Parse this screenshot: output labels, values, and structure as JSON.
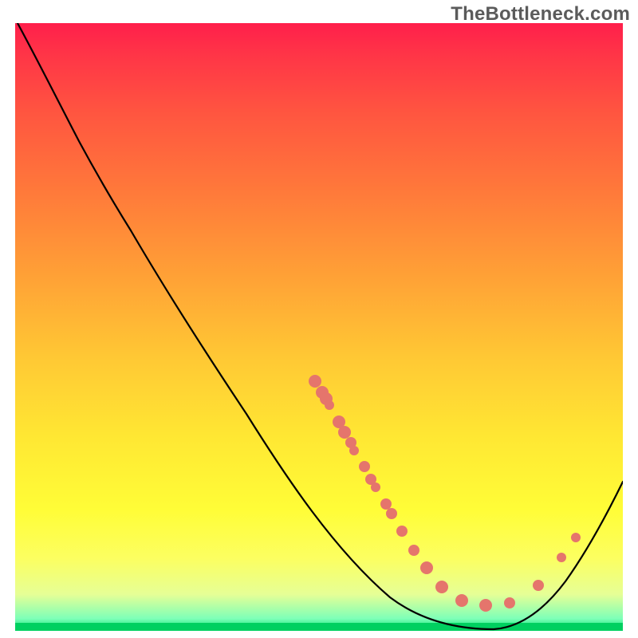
{
  "chart_data": {
    "type": "line",
    "title": "",
    "watermark": "TheBottleneck.com",
    "xlabel": "",
    "ylabel": "",
    "xlim": [
      0,
      100
    ],
    "ylim": [
      0,
      100
    ],
    "grid": false,
    "background": "vertical_gradient_red_to_green",
    "colors": {
      "top": "#ff1f4b",
      "bottom": "#00d060",
      "dot": "#e5756c",
      "line": "#000000"
    },
    "series": [
      {
        "name": "bottleneck-curve",
        "x": [
          0,
          10,
          20,
          30,
          40,
          50,
          60,
          70,
          78,
          85,
          92,
          100
        ],
        "y": [
          100,
          81,
          66,
          52,
          39,
          26,
          15,
          6,
          0.5,
          2,
          10,
          25
        ]
      }
    ],
    "dots": {
      "name": "sample-points",
      "x": [
        49,
        50,
        51,
        52,
        53,
        54,
        55,
        56,
        57,
        59,
        61,
        63,
        66,
        68,
        70,
        73,
        77,
        81,
        86,
        90,
        92
      ],
      "y": [
        41,
        39,
        38,
        37,
        35,
        33,
        31,
        29,
        27,
        24,
        21,
        17,
        13,
        10,
        7,
        5,
        4,
        4,
        7,
        12,
        15
      ]
    }
  }
}
